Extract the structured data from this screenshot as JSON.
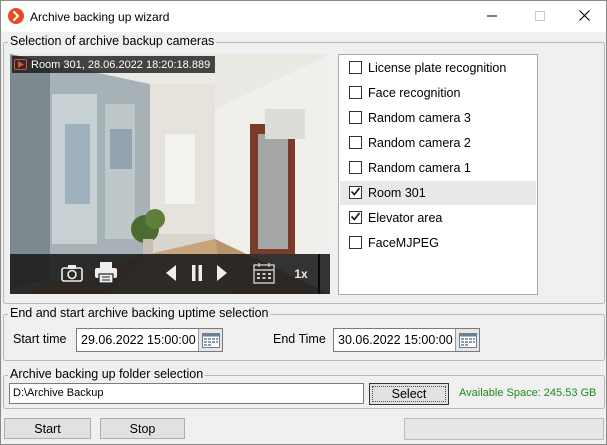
{
  "window": {
    "title": "Archive backing up wizard",
    "accent": "#e8491d"
  },
  "cameras_group": {
    "title": "Selection of archive backup cameras",
    "video": {
      "overlay": "Room 301, 28.06.2022 18:20:18.889",
      "speed": "1x"
    },
    "cameras": [
      {
        "label": "License plate recognition",
        "checked": false
      },
      {
        "label": "Face recognition",
        "checked": false
      },
      {
        "label": "Random camera 3",
        "checked": false
      },
      {
        "label": "Random camera 2",
        "checked": false
      },
      {
        "label": "Random camera 1",
        "checked": false
      },
      {
        "label": "Room 301",
        "checked": true,
        "selected": true
      },
      {
        "label": "Elevator area",
        "checked": true
      },
      {
        "label": "FaceMJPEG",
        "checked": false
      }
    ]
  },
  "time_group": {
    "title": "End and start archive backing uptime selection",
    "start_label": "Start time",
    "start_value": "29.06.2022 15:00:00",
    "end_label": "End Time",
    "end_value": "30.06.2022 15:00:00"
  },
  "folder_group": {
    "title": "Archive backing up folder selection",
    "path": "D:\\Archive Backup",
    "select_label": "Select",
    "available_space": "Available Space: 245.53 GB"
  },
  "actions": {
    "start_label": "Start",
    "stop_label": "Stop",
    "progress": 0
  }
}
